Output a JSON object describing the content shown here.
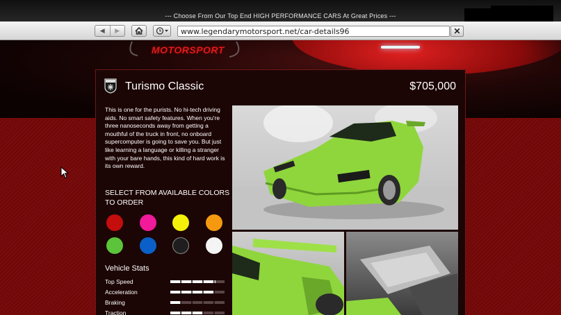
{
  "window": {
    "slogan": "--- Choose From Our Top End HIGH PERFORMANCE CARS At Great Prices ---"
  },
  "browser": {
    "url": "www.legendarymotorsport.net/car-details96",
    "icons": {
      "back": "back-arrow-icon",
      "forward": "forward-arrow-icon",
      "home": "home-icon",
      "history": "clock-icon",
      "close": "close-icon"
    }
  },
  "site": {
    "logo_text": "MOTORSPORT"
  },
  "car": {
    "name": "Turismo Classic",
    "price": "$705,000",
    "description": "This is one for the purists. No hi-tech driving aids. No smart safety features. When you're three nanoseconds away from getting a mouthful of the truck in front, no onboard supercomputer is going to save you. But just like learning a language or killing a stranger with your bare hands, this kind of hard work is its own reward.",
    "colors_heading": "SELECT FROM AVAILABLE COLORS TO ORDER",
    "colors": [
      {
        "name": "red",
        "hex": "#c40d0d"
      },
      {
        "name": "pink",
        "hex": "#f01a9a"
      },
      {
        "name": "yellow",
        "hex": "#f5f00a"
      },
      {
        "name": "orange",
        "hex": "#f59a10"
      },
      {
        "name": "green",
        "hex": "#5cc43a"
      },
      {
        "name": "blue",
        "hex": "#0a60c8"
      },
      {
        "name": "black",
        "hex": "#1e1e1e"
      },
      {
        "name": "white",
        "hex": "#f4f4f4"
      }
    ],
    "stats_title": "Vehicle Stats",
    "stats": [
      {
        "label": "Top Speed",
        "value": 0.82
      },
      {
        "label": "Acceleration",
        "value": 0.8
      },
      {
        "label": "Braking",
        "value": 0.2
      },
      {
        "label": "Traction",
        "value": 0.6
      }
    ]
  },
  "theme": {
    "accent": "#e01a1a",
    "panel": "#1c0505",
    "car_body": "#8fd63c"
  }
}
